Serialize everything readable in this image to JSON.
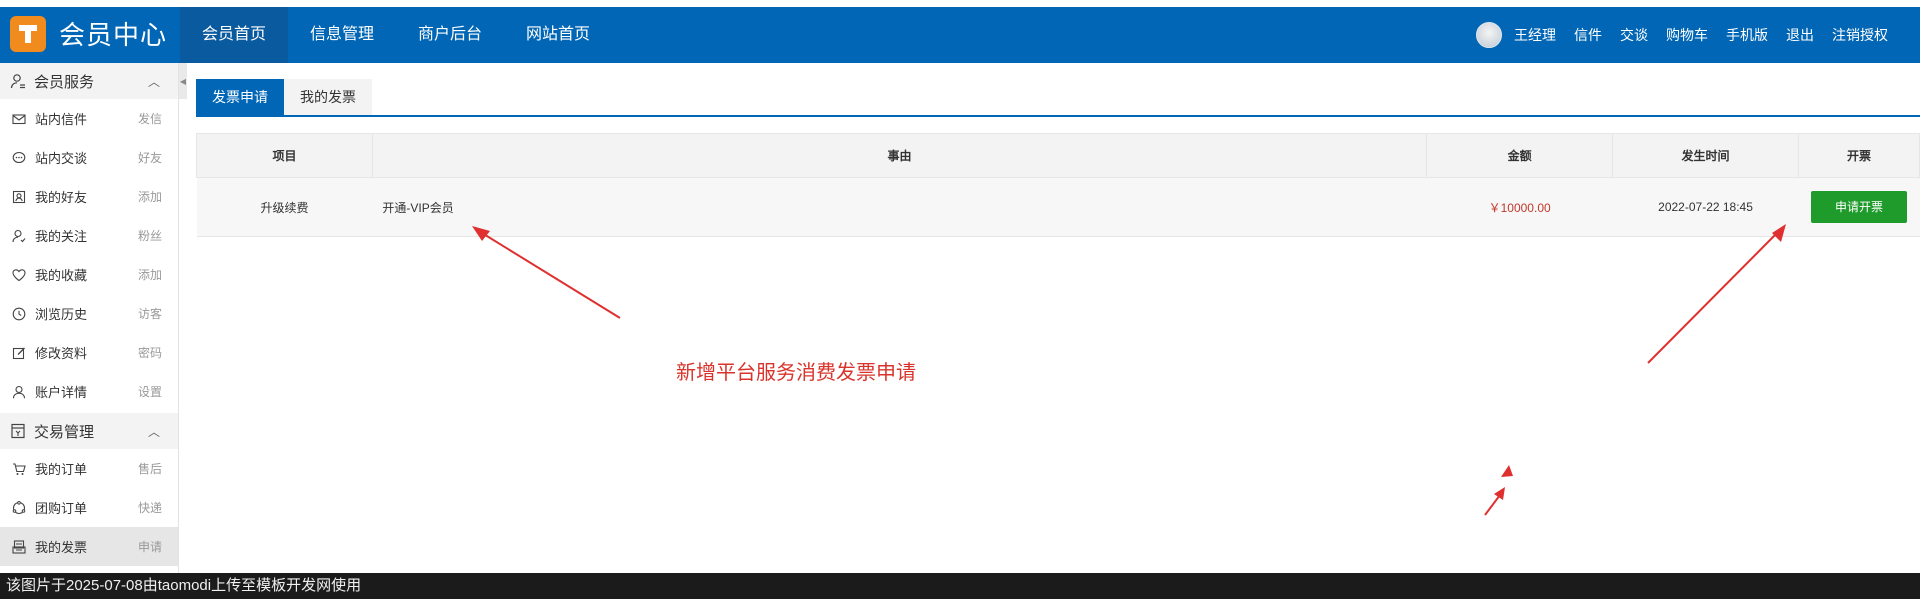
{
  "app": {
    "title": "会员中心",
    "logo_letter": "T"
  },
  "nav": {
    "items": [
      {
        "label": "会员首页",
        "active": true
      },
      {
        "label": "信息管理",
        "active": false
      },
      {
        "label": "商户后台",
        "active": false
      },
      {
        "label": "网站首页",
        "active": false
      }
    ]
  },
  "user_links": {
    "username": "王经理",
    "links": [
      "信件",
      "交谈",
      "购物车",
      "手机版",
      "退出",
      "注销授权"
    ]
  },
  "sidebar": {
    "sections": [
      {
        "title": "会员服务",
        "icon": "user-icon",
        "items": [
          {
            "label": "站内信件",
            "extra": "发信",
            "icon": "mail-icon"
          },
          {
            "label": "站内交谈",
            "extra": "好友",
            "icon": "chat-icon"
          },
          {
            "label": "我的好友",
            "extra": "添加",
            "icon": "contact-card-icon"
          },
          {
            "label": "我的关注",
            "extra": "粉丝",
            "icon": "user-follow-icon"
          },
          {
            "label": "我的收藏",
            "extra": "添加",
            "icon": "heart-icon"
          },
          {
            "label": "浏览历史",
            "extra": "访客",
            "icon": "clock-icon"
          },
          {
            "label": "修改资料",
            "extra": "密码",
            "icon": "edit-icon"
          },
          {
            "label": "账户详情",
            "extra": "设置",
            "icon": "account-icon"
          }
        ]
      },
      {
        "title": "交易管理",
        "icon": "trade-icon",
        "items": [
          {
            "label": "我的订单",
            "extra": "售后",
            "icon": "order-icon"
          },
          {
            "label": "团购订单",
            "extra": "快递",
            "icon": "group-buy-icon"
          },
          {
            "label": "我的发票",
            "extra": "申请",
            "icon": "invoice-icon",
            "active": true
          }
        ]
      }
    ]
  },
  "tabs": [
    {
      "label": "发票申请",
      "active": true
    },
    {
      "label": "我的发票",
      "active": false
    }
  ],
  "table": {
    "headers": [
      "项目",
      "事由",
      "金额",
      "发生时间",
      "开票"
    ],
    "rows": [
      {
        "item": "升级续费",
        "reason": "开通-VIP会员",
        "amount": "￥10000.00",
        "time": "2022-07-22 18:45",
        "action": "申请开票"
      }
    ]
  },
  "annotation": {
    "text": "新增平台服务消费发票申请",
    "color": "#d9342b"
  },
  "footer": {
    "text": "该图片于2025-07-08由taomodi上传至模板开发网使用"
  },
  "colors": {
    "brand_blue": "#0066b5",
    "logo_orange": "#f28b1e",
    "button_green": "#1f9b2b",
    "amount_red": "#c0392b"
  }
}
